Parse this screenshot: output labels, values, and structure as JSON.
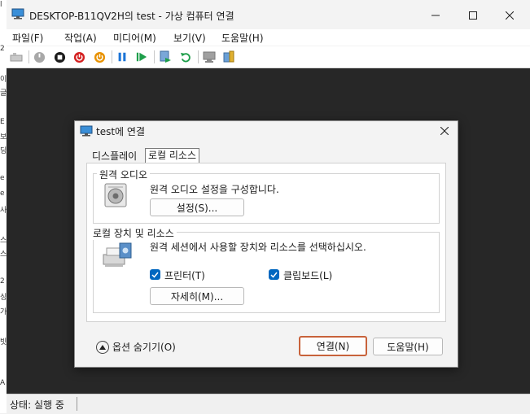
{
  "window": {
    "title": "DESKTOP-B11QV2H의 test - 가상 컴퓨터 연결",
    "icon": "monitor-icon"
  },
  "background_fragments": [
    "l",
    "2",
    "이",
    "글",
    "E",
    "보",
    "딩",
    "e",
    "e",
    "사",
    "스",
    "스",
    "2",
    "싱",
    "가",
    "빗",
    "A"
  ],
  "menu": [
    {
      "label": "파일(F)"
    },
    {
      "label": "작업(A)"
    },
    {
      "label": "미디어(M)"
    },
    {
      "label": "보기(V)"
    },
    {
      "label": "도움말(H)"
    }
  ],
  "toolbar": {
    "colors": {
      "start": "#1e9e4a",
      "pause": "#1b74d6",
      "shutdown": "#d42020",
      "power": "#e89200"
    }
  },
  "status": {
    "text": "상태: 실행 중"
  },
  "dialog": {
    "title": "test에 연결",
    "tabs": [
      {
        "label": "디스플레이"
      },
      {
        "label": "로컬 리소스"
      }
    ],
    "remote_audio": {
      "title": "원격 오디오",
      "description": "원격 오디오 설정을 구성합니다.",
      "button": "설정(S)..."
    },
    "local_devices": {
      "title": "로컬 장치 및 리소스",
      "description": "원격 세션에서 사용할 장치와 리소스를 선택하십시오.",
      "printer_label": "프린터(T)",
      "printer_checked": true,
      "clipboard_label": "클립보드(L)",
      "clipboard_checked": true,
      "more_button": "자세히(M)..."
    },
    "hide_options_label": "옵션 숨기기(O)",
    "connect_button": "연결(N)",
    "help_button": "도움말(H)"
  }
}
